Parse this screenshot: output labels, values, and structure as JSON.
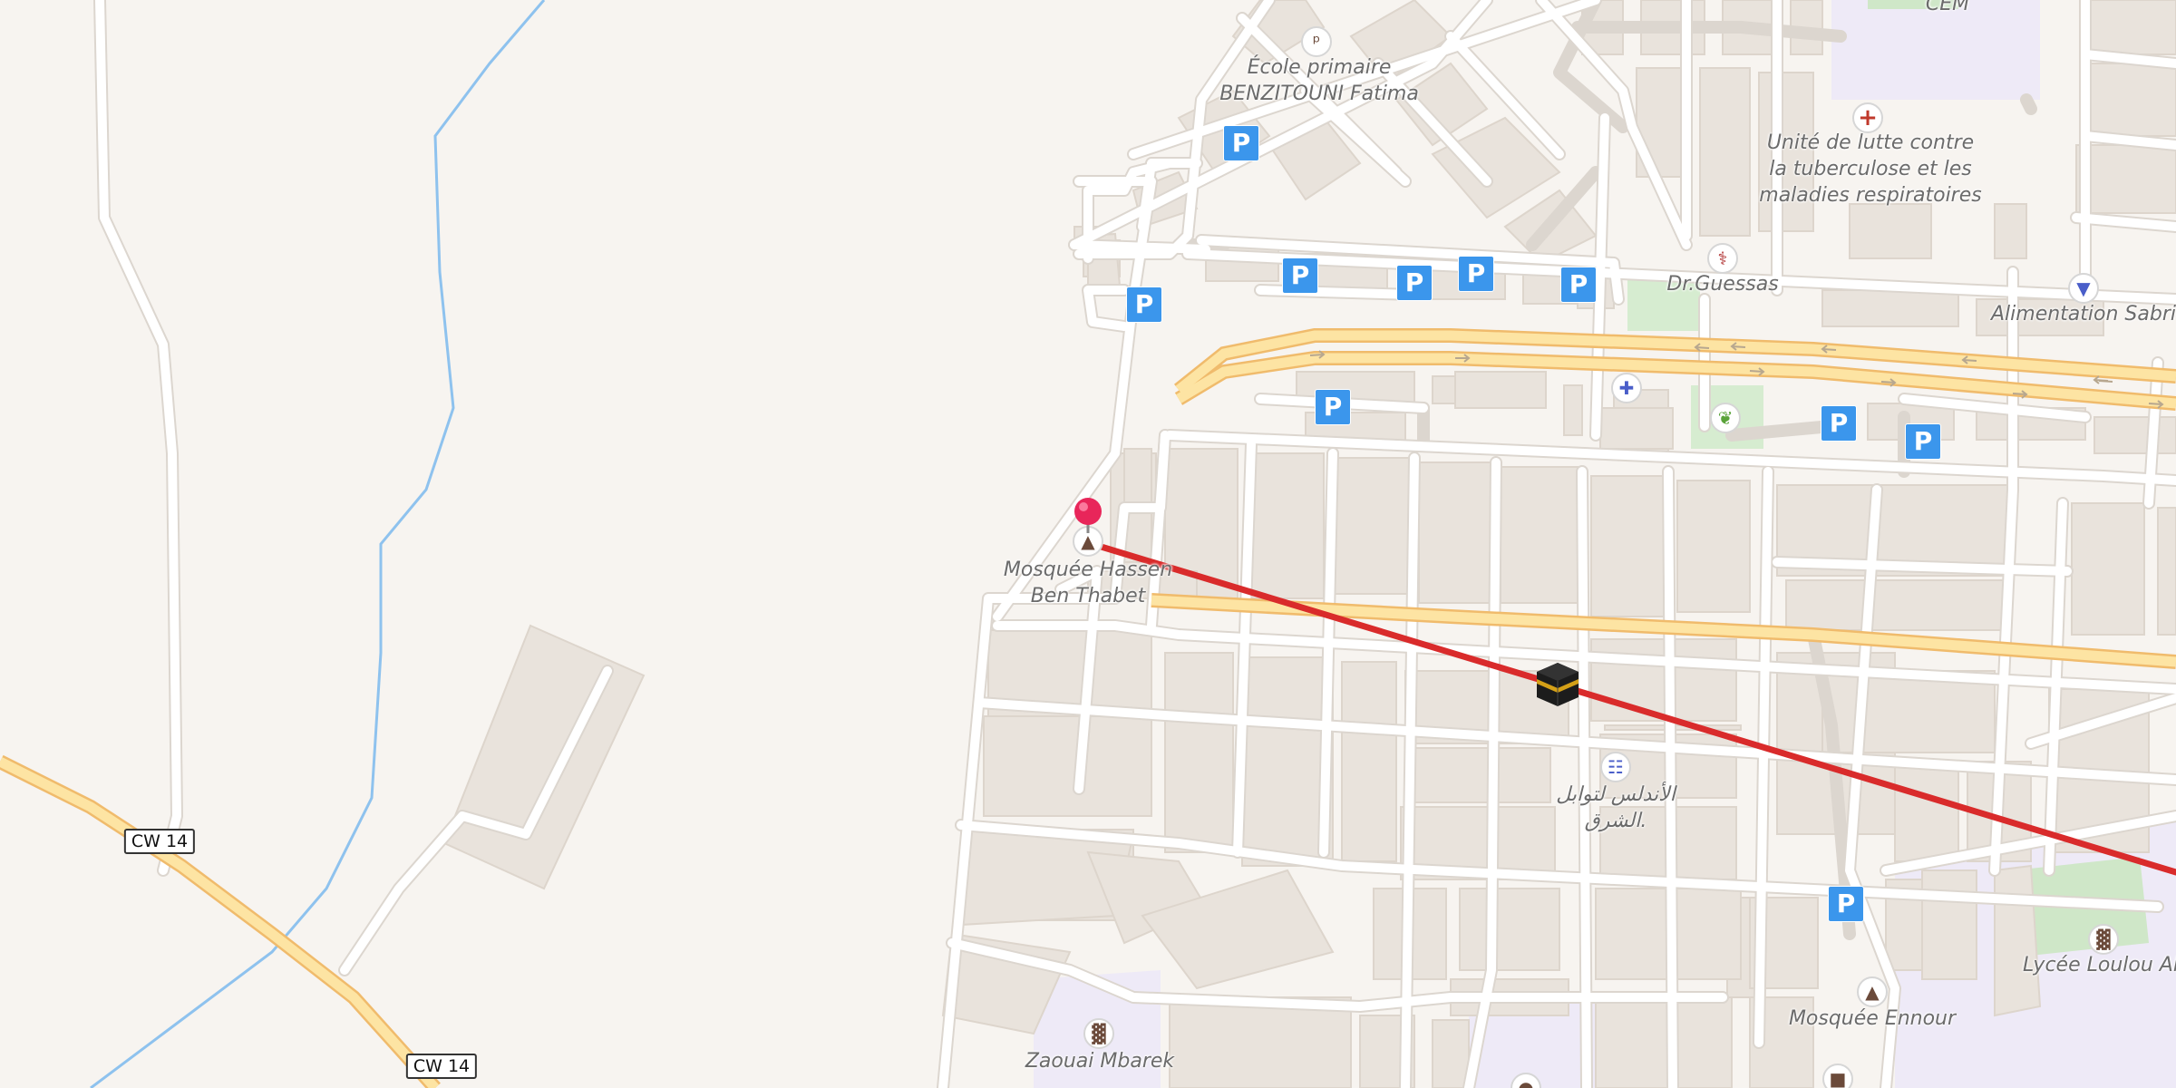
{
  "map": {
    "labels": {
      "ecole": "École primaire\nBENZITOUNI Fatima",
      "cem": "CEM",
      "unite": "Unité de lutte contre\nla tuberculose et les\nmaladies respiratoires",
      "guessas": "Dr.Guessas",
      "sabri": "Alimentation Sabri",
      "mosquee_hassen": "Mosquée Hassen\nBen Thabet",
      "andalous": "الأندلس لتوابل\nالشرق.",
      "lycee": "Lycée Loulou Ali",
      "mosquee_ennour": "Mosquée Ennour",
      "zaouai": "Zaouai Mbarek"
    },
    "road_shields": [
      "CW 14",
      "CW 14"
    ],
    "parking_label": "P",
    "colors": {
      "background": "#f7f4f0",
      "building": "#e8e1da",
      "road": "#ffffff",
      "road_casing": "#dcd6cf",
      "main_road": "#fde4a3",
      "main_road_casing": "#f0bb6c",
      "water": "#8ec2ee",
      "park": "#d6ecd0",
      "school_area": "#eeeaf7",
      "parking_blue": "#3b96ec",
      "route_line": "#d92b2b",
      "pin_pink": "#e8265a"
    },
    "icons": [
      "school-icon",
      "hospital-icon",
      "doctor-icon",
      "shop-basket-icon",
      "pharmacy-icon",
      "garden-center-icon",
      "mosque-icon",
      "supermarket-icon",
      "parking-icon",
      "kaaba-icon",
      "location-pin-icon"
    ]
  }
}
